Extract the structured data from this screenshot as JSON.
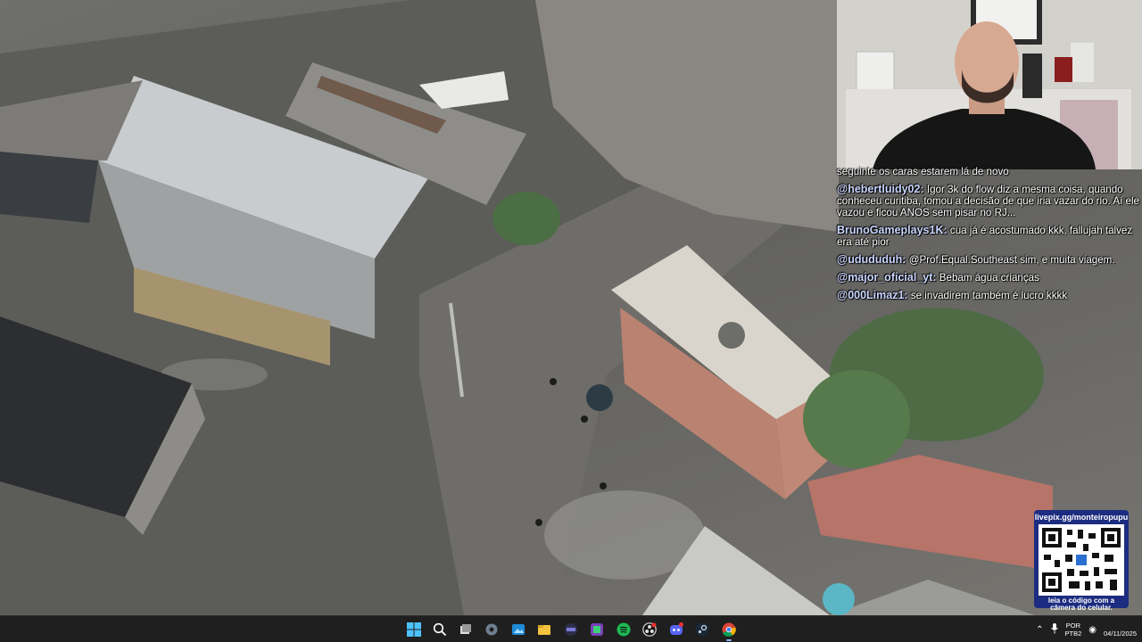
{
  "stream": {
    "chat": [
      {
        "user": "",
        "text": "seguinte os caras estarem lá de novo"
      },
      {
        "user": "@hebertluidy02",
        "text": "Igor 3k do flow diz a mesma coisa, quando conheceu curitiba, tomou a decisão de que iria vazar do rio. Aí ele vazou e ficou ANOS sem pisar no RJ..."
      },
      {
        "user": "BrunoGameplays1K",
        "text": "cua já é acostumado kkk, fallujah talvez era até pior"
      },
      {
        "user": "@udududuh",
        "text": "@Prof.Equal.Southeast sim, e muita viagem."
      },
      {
        "user": "@major_oficial_yt",
        "text": "Bebam água crianças"
      },
      {
        "user": "@000Limaz1",
        "text": "se invadirem também é lucro kkkk"
      }
    ],
    "qr": {
      "url": "livepix.gg/monteiropupu",
      "caption_line1": "leia o código com a",
      "caption_line2": "câmera do celular."
    }
  },
  "taskbar": {
    "icons": [
      "windows-start-icon",
      "search-icon",
      "task-view-icon",
      "settings-icon",
      "photos-icon",
      "file-explorer-icon",
      "terminal-icon",
      "app-icon",
      "spotify-icon",
      "obs-icon",
      "discord-icon",
      "steam-icon",
      "chrome-icon"
    ],
    "lang_line1": "POR",
    "lang_line2": "PTB2",
    "date": "04/11/2025",
    "accent": "#8ab4f8"
  }
}
